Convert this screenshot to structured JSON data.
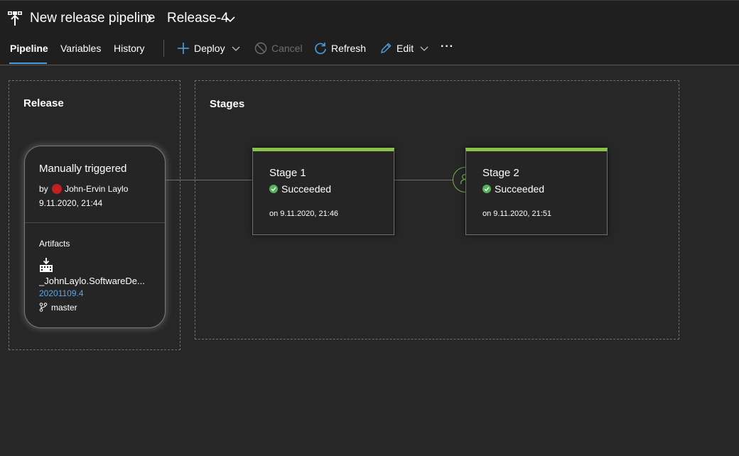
{
  "header": {
    "pipeline_name": "New release pipeline",
    "release_name": "Release-4"
  },
  "tabs": [
    {
      "label": "Pipeline",
      "active": true
    },
    {
      "label": "Variables",
      "active": false
    },
    {
      "label": "History",
      "active": false
    }
  ],
  "toolbar": {
    "deploy": "Deploy",
    "cancel": "Cancel",
    "refresh": "Refresh",
    "edit": "Edit",
    "more": "···"
  },
  "release_panel": {
    "title": "Release",
    "trigger": "Manually triggered",
    "by_label": "by",
    "author": "John-Ervin Laylo",
    "date": "9.11.2020, 21:44",
    "artifacts_label": "Artifacts",
    "artifact_name": "_JohnLaylo.SoftwareDe...",
    "artifact_build": "20201109.4",
    "branch": "master"
  },
  "stages_panel": {
    "title": "Stages",
    "stages": [
      {
        "name": "Stage 1",
        "status": "Succeeded",
        "date": "on 9.11.2020, 21:46"
      },
      {
        "name": "Stage 2",
        "status": "Succeeded",
        "date": "on 9.11.2020, 21:51"
      }
    ]
  },
  "colors": {
    "background": "#272727",
    "header": "#1f1f1f",
    "accent_blue": "#4a9fe0",
    "success_green": "#55b15a",
    "stage_bar": "#8bc34a",
    "link_blue": "#5aa6ef"
  }
}
